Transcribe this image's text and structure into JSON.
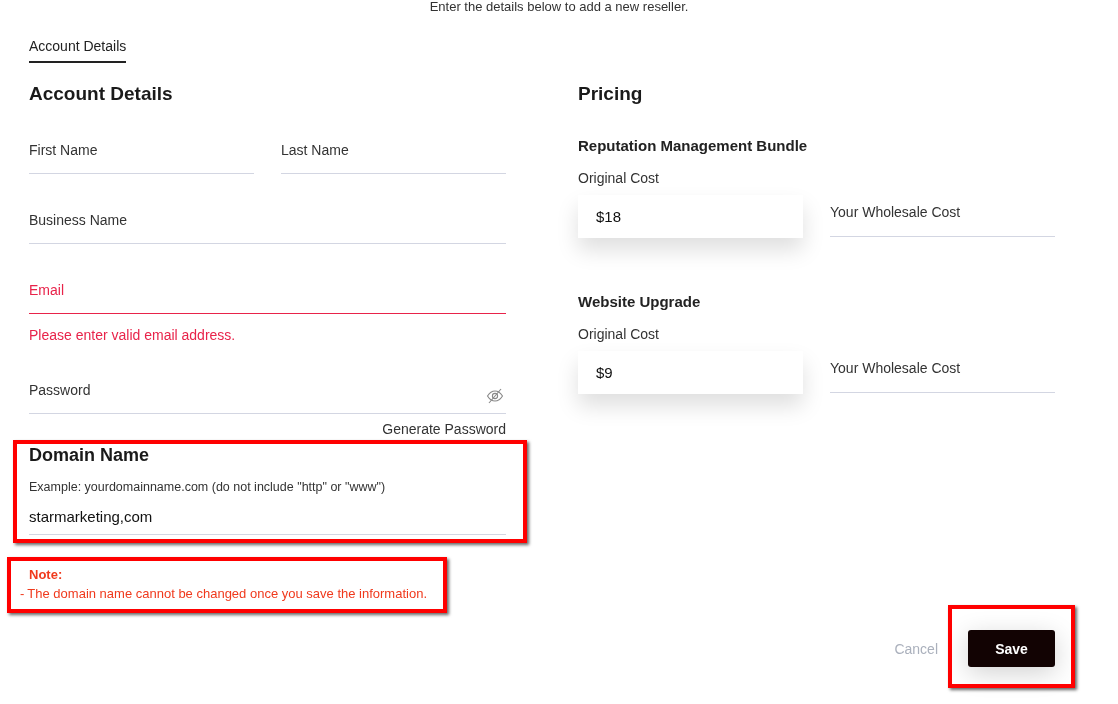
{
  "subtitle": "Enter the details below to add a new reseller.",
  "tabs": [
    {
      "label": "Account Details",
      "selected": true
    }
  ],
  "account": {
    "heading": "Account Details",
    "rows": [
      {
        "fields": [
          {
            "placeholder": "First Name",
            "kind": "text",
            "invalid": false
          },
          {
            "placeholder": "Last Name",
            "kind": "text",
            "invalid": false
          }
        ]
      },
      {
        "fields": [
          {
            "placeholder": "Business Name",
            "kind": "text",
            "invalid": false
          }
        ]
      },
      {
        "fields": [
          {
            "placeholder": "Email",
            "kind": "text",
            "invalid": true,
            "error": "Please enter valid email address."
          }
        ]
      },
      {
        "fields": [
          {
            "placeholder": "Password",
            "kind": "password",
            "invalid": false,
            "link": "Generate Password"
          }
        ]
      }
    ]
  },
  "domain": {
    "heading": "Domain Name",
    "hint": "Example: yourdomainname.com (do not include \"http\" or \"www\")",
    "value": "starmarketing,com"
  },
  "note": {
    "title": "Note:",
    "bullet": "-",
    "text": "The domain name cannot be changed once you save the information."
  },
  "pricing": {
    "heading": "Pricing",
    "items": [
      {
        "name": "Reputation Management Bundle",
        "original_label": "Original Cost",
        "original_value": "$18",
        "wholesale_placeholder": "Your Wholesale Cost"
      },
      {
        "name": "Website Upgrade",
        "original_label": "Original Cost",
        "original_value": "$9",
        "wholesale_placeholder": "Your Wholesale Cost"
      }
    ]
  },
  "actions": {
    "cancel": "Cancel",
    "save": "Save"
  }
}
